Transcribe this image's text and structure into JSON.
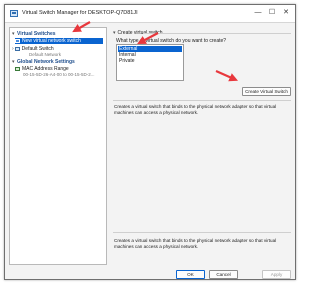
{
  "window": {
    "title": "Virtual Switch Manager for DESKTOP-Q7D81JI"
  },
  "titlebar": {
    "minimize_glyph": "—",
    "maximize_glyph": "☐",
    "close_glyph": "✕"
  },
  "tree": {
    "virtual_switches_header": "Virtual Switches",
    "new_switch_label": "New virtual network switch",
    "default_switch_label": "Default Switch",
    "default_network_label": "Default Network",
    "global_settings_header": "Global Network Settings",
    "mac_range_label": "MAC Address Range",
    "mac_range_value": "00-15-5D-26-A4-00 to 00-15-5D-2..."
  },
  "create": {
    "section_title": "Create virtual switch",
    "question": "What type of virtual switch do you want to create?",
    "options": [
      "External",
      "Internal",
      "Private"
    ],
    "selected": "External",
    "button_label": "Create Virtual Switch",
    "description": "Creates a virtual switch that binds to the physical network adapter so that virtual machines can access a physical network.",
    "description_bottom": "Creates a virtual switch that binds to the physical network adapter so that virtual machines can access a physical network."
  },
  "footer": {
    "ok_label": "OK",
    "cancel_label": "Cancel",
    "apply_label": "Apply"
  },
  "colors": {
    "selection": "#0a64d0",
    "annotation_arrow": "#e8383d",
    "header_text": "#1f4e8c"
  },
  "icons": [
    "app-icon",
    "switch-icon",
    "globe-icon",
    "minimize-icon",
    "maximize-icon",
    "close-icon",
    "expand-caret-icon"
  ]
}
